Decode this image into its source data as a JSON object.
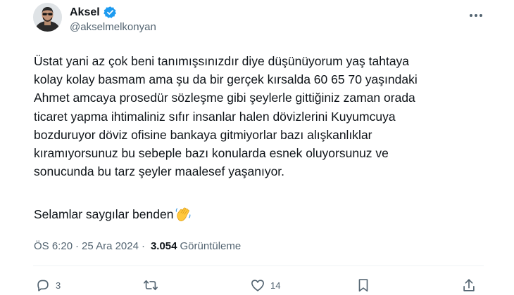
{
  "author": {
    "display_name": "Aksel",
    "handle": "@akselmelkonyan",
    "verified_color": "#1d9bf0"
  },
  "tweet": {
    "lines": [
      "Üstat yani az çok beni tanımışsınızdır diye düşünüyorum  yaş tahtaya",
      "kolay kolay basmam ama şu da bir gerçek kırsalda 60 65 70 yaşındaki",
      "Ahmet amcaya prosedür sözleşme gibi şeylerle gittiğiniz zaman orada",
      "ticaret yapma ihtimaliniz sıfır insanlar halen dövizlerini Kuyumcuya",
      "bozduruyor döviz ofisine bankaya gitmiyorlar bazı alışkanlıklar",
      "kıramıyorsunuz bu sebeple bazı konularda esnek oluyorsunuz ve",
      "sonucunda bu tarz şeyler maalesef yaşanıyor."
    ],
    "signoff": "Selamlar saygılar benden",
    "signoff_emoji": "waving-hands-emoji"
  },
  "meta": {
    "time": "ÖS 6:20",
    "separator": "·",
    "date": "25 Ara 2024",
    "views_count": "3.054",
    "views_label": "Görüntüleme"
  },
  "actions": {
    "replies": "3",
    "reposts": "",
    "likes": "14"
  },
  "icons": {
    "more": "more-horizontal-icon",
    "reply": "reply-icon",
    "repost": "repost-icon",
    "like": "heart-icon",
    "bookmark": "bookmark-icon",
    "share": "share-icon"
  },
  "colors": {
    "text_primary": "#0f1419",
    "text_secondary": "#536471",
    "accent": "#1d9bf0"
  }
}
